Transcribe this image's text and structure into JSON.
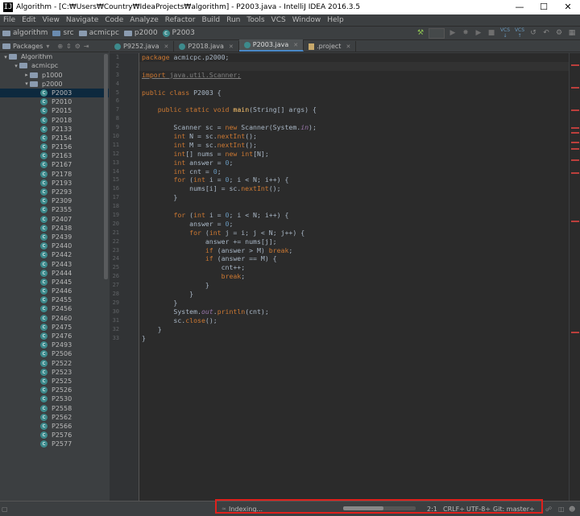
{
  "window": {
    "title": "Algorithm - [C:₩Users₩Country₩IdeaProjects₩algorithm] - P2003.java - IntelliJ IDEA 2016.3.5",
    "controls": [
      "—",
      "☐",
      "✕"
    ]
  },
  "menu": [
    "File",
    "Edit",
    "View",
    "Navigate",
    "Code",
    "Analyze",
    "Refactor",
    "Build",
    "Run",
    "Tools",
    "VCS",
    "Window",
    "Help"
  ],
  "breadcrumb": [
    "algorithm",
    "src",
    "acmicpc",
    "p2000",
    "P2003"
  ],
  "project_panel": {
    "view_label": "Packages",
    "tree": [
      {
        "label": "Algorithm",
        "level": 0,
        "expanded": true,
        "type": "module"
      },
      {
        "label": "acmicpc",
        "level": 1,
        "expanded": true,
        "type": "package"
      },
      {
        "label": "p1000",
        "level": 2,
        "expanded": false,
        "type": "package"
      },
      {
        "label": "p2000",
        "level": 2,
        "expanded": true,
        "type": "package"
      },
      {
        "label": "P2003",
        "level": 3,
        "type": "class",
        "selected": true
      },
      {
        "label": "P2010",
        "level": 3,
        "type": "class"
      },
      {
        "label": "P2015",
        "level": 3,
        "type": "class"
      },
      {
        "label": "P2018",
        "level": 3,
        "type": "class"
      },
      {
        "label": "P2133",
        "level": 3,
        "type": "class"
      },
      {
        "label": "P2154",
        "level": 3,
        "type": "class"
      },
      {
        "label": "P2156",
        "level": 3,
        "type": "class"
      },
      {
        "label": "P2163",
        "level": 3,
        "type": "class"
      },
      {
        "label": "P2167",
        "level": 3,
        "type": "class"
      },
      {
        "label": "P2178",
        "level": 3,
        "type": "class"
      },
      {
        "label": "P2193",
        "level": 3,
        "type": "class"
      },
      {
        "label": "P2293",
        "level": 3,
        "type": "class"
      },
      {
        "label": "P2309",
        "level": 3,
        "type": "class"
      },
      {
        "label": "P2355",
        "level": 3,
        "type": "class"
      },
      {
        "label": "P2407",
        "level": 3,
        "type": "class"
      },
      {
        "label": "P2438",
        "level": 3,
        "type": "class"
      },
      {
        "label": "P2439",
        "level": 3,
        "type": "class"
      },
      {
        "label": "P2440",
        "level": 3,
        "type": "class"
      },
      {
        "label": "P2442",
        "level": 3,
        "type": "class"
      },
      {
        "label": "P2443",
        "level": 3,
        "type": "class"
      },
      {
        "label": "P2444",
        "level": 3,
        "type": "class"
      },
      {
        "label": "P2445",
        "level": 3,
        "type": "class"
      },
      {
        "label": "P2446",
        "level": 3,
        "type": "class"
      },
      {
        "label": "P2455",
        "level": 3,
        "type": "class"
      },
      {
        "label": "P2456",
        "level": 3,
        "type": "class"
      },
      {
        "label": "P2460",
        "level": 3,
        "type": "class"
      },
      {
        "label": "P2475",
        "level": 3,
        "type": "class"
      },
      {
        "label": "P2476",
        "level": 3,
        "type": "class"
      },
      {
        "label": "P2493",
        "level": 3,
        "type": "class"
      },
      {
        "label": "P2506",
        "level": 3,
        "type": "class"
      },
      {
        "label": "P2522",
        "level": 3,
        "type": "class"
      },
      {
        "label": "P2523",
        "level": 3,
        "type": "class"
      },
      {
        "label": "P2525",
        "level": 3,
        "type": "class"
      },
      {
        "label": "P2526",
        "level": 3,
        "type": "class"
      },
      {
        "label": "P2530",
        "level": 3,
        "type": "class"
      },
      {
        "label": "P2558",
        "level": 3,
        "type": "class"
      },
      {
        "label": "P2562",
        "level": 3,
        "type": "class"
      },
      {
        "label": "P2566",
        "level": 3,
        "type": "class"
      },
      {
        "label": "P2576",
        "level": 3,
        "type": "class"
      },
      {
        "label": "P2577",
        "level": 3,
        "type": "class"
      }
    ]
  },
  "tabs": [
    {
      "label": "P9252.java",
      "type": "class",
      "active": false
    },
    {
      "label": "P2018.java",
      "type": "class",
      "active": false
    },
    {
      "label": "P2003.java",
      "type": "class",
      "active": true
    },
    {
      "label": ".project",
      "type": "file",
      "active": false
    }
  ],
  "editor": {
    "current_line": 2,
    "lines": [
      "package acmicpc.p2000;",
      "",
      "import java.util.Scanner;",
      "",
      "public class P2003 {",
      "",
      "    public static void main(String[] args) {",
      "",
      "        Scanner sc = new Scanner(System.in);",
      "        int N = sc.nextInt();",
      "        int M = sc.nextInt();",
      "        int[] nums = new int[N];",
      "        int answer = 0;",
      "        int cnt = 0;",
      "        for (int i = 0; i < N; i++) {",
      "            nums[i] = sc.nextInt();",
      "        }",
      "",
      "        for (int i = 0; i < N; i++) {",
      "            answer = 0;",
      "            for (int j = i; j < N; j++) {",
      "                answer += nums[j];",
      "                if (answer > M) break;",
      "                if (answer == M) {",
      "                    cnt++;",
      "                    break;",
      "                }",
      "            }",
      "        }",
      "        System.out.println(cnt);",
      "        sc.close();",
      "    }",
      "}"
    ]
  },
  "status": {
    "indexing": "Indexing...",
    "position": "2:1",
    "line_sep": "CRLF÷",
    "encoding": "UTF-8÷",
    "git": "Git: master÷",
    "indexing_progress": 0.55
  },
  "colors": {
    "keyword": "#cc7832",
    "method": "#ffc66d",
    "number": "#6897bb",
    "field": "#9876aa",
    "text": "#a9b7c6",
    "error_mark": "#bc3f3c"
  }
}
